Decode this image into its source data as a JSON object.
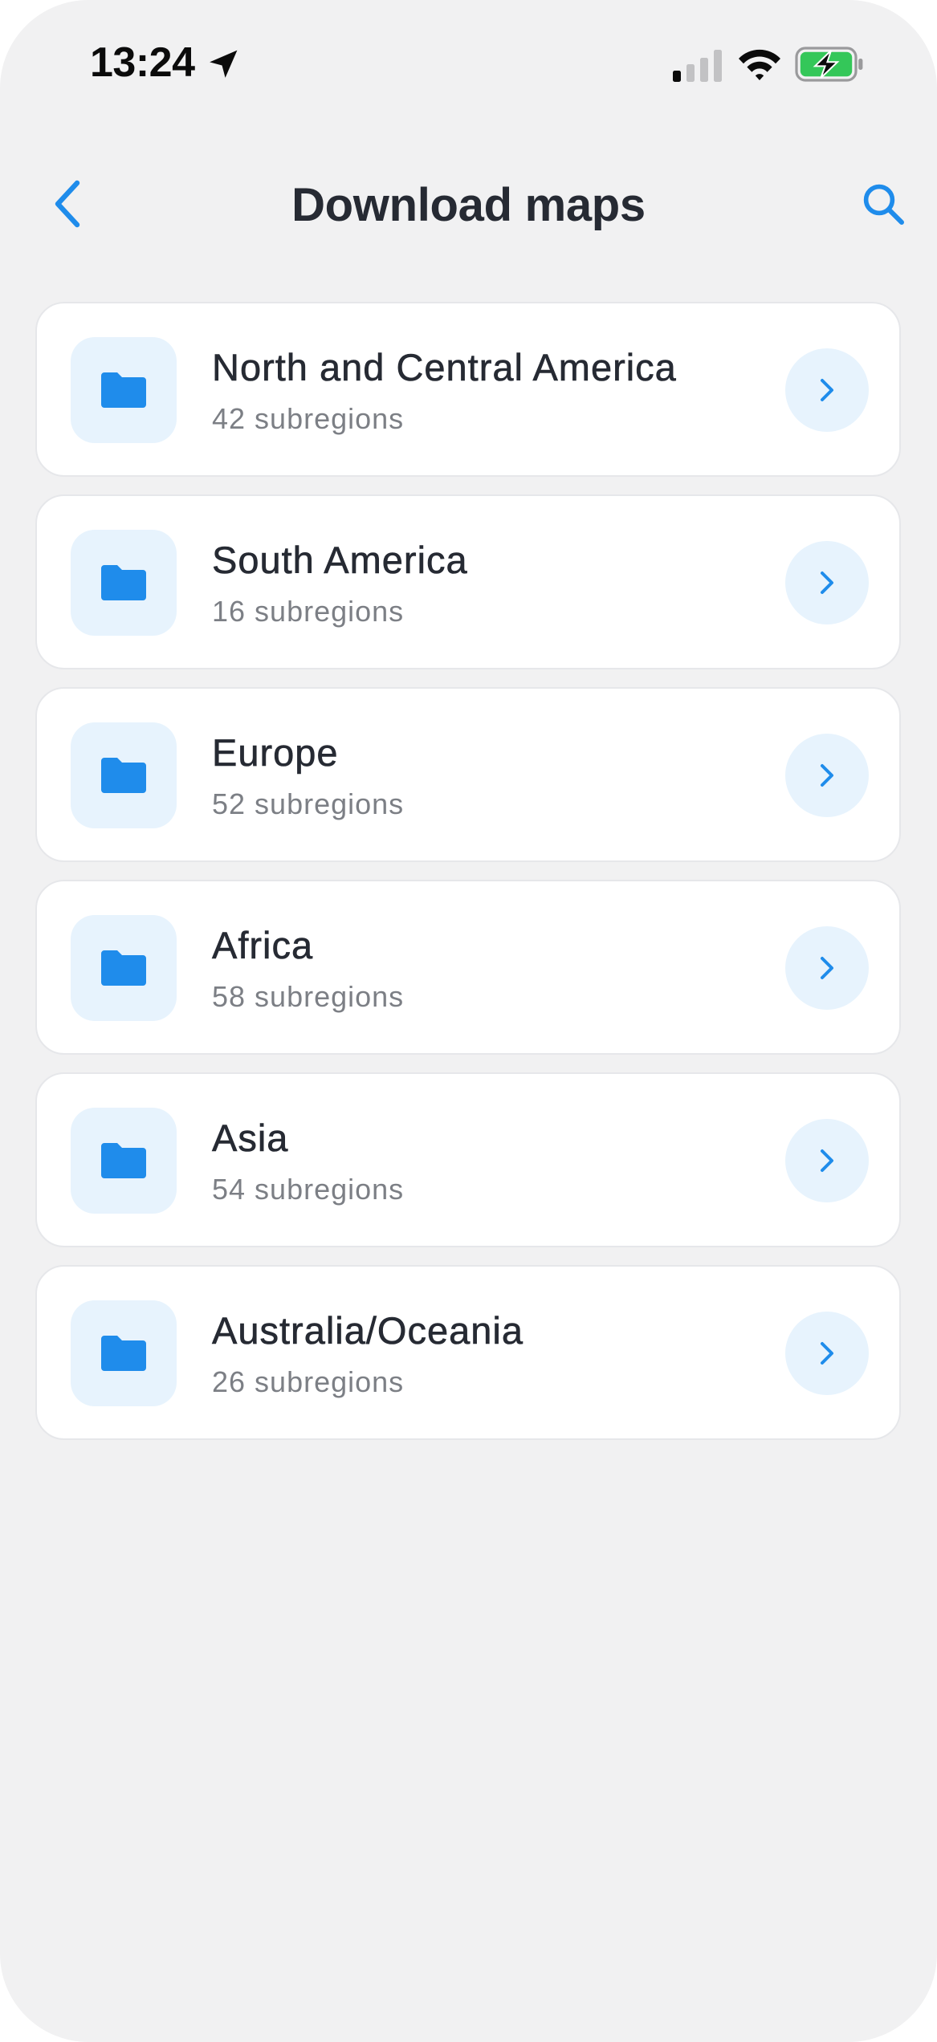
{
  "status_bar": {
    "time": "13:24",
    "icons": [
      "location-arrow-icon",
      "cellular-signal-icon",
      "wifi-icon",
      "battery-charging-icon"
    ],
    "battery_color": "#34c759"
  },
  "header": {
    "title": "Download maps",
    "back_icon": "chevron-left-icon",
    "search_icon": "search-icon"
  },
  "colors": {
    "accent": "#1f8ceb",
    "tile_background": "#e7f3fd",
    "screen_background": "#f1f1f2",
    "card_background": "#ffffff",
    "title_text": "#262a33",
    "secondary_text": "#7c7f85"
  },
  "regions": [
    {
      "name": "North and Central America",
      "subregions": "42 subregions",
      "icon": "folder-icon"
    },
    {
      "name": "South America",
      "subregions": "16 subregions",
      "icon": "folder-icon"
    },
    {
      "name": "Europe",
      "subregions": "52 subregions",
      "icon": "folder-icon"
    },
    {
      "name": "Africa",
      "subregions": "58 subregions",
      "icon": "folder-icon"
    },
    {
      "name": "Asia",
      "subregions": "54 subregions",
      "icon": "folder-icon"
    },
    {
      "name": "Australia/Oceania",
      "subregions": "26 subregions",
      "icon": "folder-icon"
    }
  ]
}
